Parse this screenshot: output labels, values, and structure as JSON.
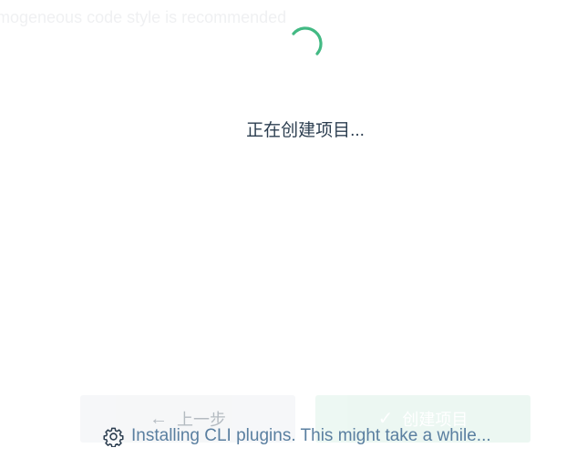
{
  "background": {
    "faded_text": "mogeneous code style is recommended",
    "prev_button_label": "上一步",
    "create_button_label": "创建项目",
    "prev_icon": "arrow-left-icon",
    "create_icon": "check-icon"
  },
  "loading": {
    "message": "正在创建项目...",
    "spinner_icon": "spinner-icon",
    "accent_color": "#42b983"
  },
  "status": {
    "icon": "gear-icon",
    "text": "Installing CLI plugins. This might take a while..."
  }
}
